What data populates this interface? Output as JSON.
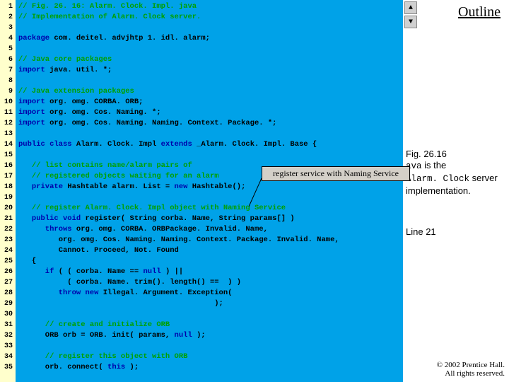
{
  "outline_label": "Outline",
  "caption": {
    "fig_label": "Fig. 26.16",
    "line1_code": "ava",
    "line1_rest": " is the",
    "line2_code": "Alarm. Clock",
    "line2_rest": " server implementation."
  },
  "line_ref": "Line 21",
  "callout_text": "register service with Naming Service",
  "copyright": {
    "line1": "© 2002 Prentice Hall.",
    "line2": "All rights reserved."
  },
  "line_numbers": [
    "1",
    "2",
    "3",
    "4",
    "5",
    "6",
    "7",
    "8",
    "9",
    "10",
    "11",
    "12",
    "13",
    "14",
    "15",
    "16",
    "17",
    "18",
    "19",
    "20",
    "21",
    "22",
    "23",
    "24",
    "25",
    "26",
    "27",
    "28",
    "29",
    "30",
    "31",
    "32",
    "33",
    "34",
    "35"
  ],
  "code": {
    "l1": "// Fig. 26. 16: Alarm. Clock. Impl. java",
    "l2": "// Implementation of Alarm. Clock server.",
    "l4": "package com. deitel. advjhtp 1. idl. alarm;",
    "l4_kw": "package",
    "l4_rest": " com. deitel. advjhtp 1. idl. alarm;",
    "l6": "// Java core packages",
    "l7_kw": "import",
    "l7_rest": " java. util. *;",
    "l9": "// Java extension packages",
    "l10_kw": "import",
    "l10_rest": " org. omg. CORBA. ORB;",
    "l11_kw": "import",
    "l11_rest": " org. omg. Cos. Naming. *;",
    "l12_kw": "import",
    "l12_rest": " org. omg. Cos. Naming. Naming. Context. Package. *;",
    "l14_a": "public class ",
    "l14_b": "Alarm. Clock. Impl ",
    "l14_c": "extends ",
    "l14_d": "_Alarm. Clock. Impl. Base {",
    "l16": "   // list contains name/alarm pairs of",
    "l17": "   // registered objects waiting for an alarm",
    "l18_a": "   private ",
    "l18_b": "Hashtable alarm. List = ",
    "l18_c": "new ",
    "l18_d": "Hashtable();",
    "l20": "   // register Alarm. Clock. Impl object with Naming Service",
    "l21_a": "   public void ",
    "l21_b": "register( String corba. Name, String params[] )",
    "l22_a": "      throws ",
    "l22_b": "org. omg. CORBA. ORBPackage. Invalid. Name,",
    "l23": "         org. omg. Cos. Naming. Naming. Context. Package. Invalid. Name,",
    "l24": "         Cannot. Proceed, Not. Found",
    "l25": "   {",
    "l26_a": "      if ",
    "l26_b": "( ( corba. Name == ",
    "l26_c": "null ",
    "l26_d": ") ||",
    "l27_a": "           ( corba. Name. trim(). length() == ",
    "l27_b": " ) )",
    "l28_a": "         throw new ",
    "l28_b": "Illegal. Argument. Exception(",
    "l29": "                                            );",
    "l31": "      // create and initialize ORB",
    "l32_a": "      ORB orb = ORB. init( params, ",
    "l32_b": "null ",
    "l32_c": ");",
    "l34": "      // register this object with ORB",
    "l35_a": "      orb. connect( ",
    "l35_b": "this ",
    "l35_c": ");"
  }
}
